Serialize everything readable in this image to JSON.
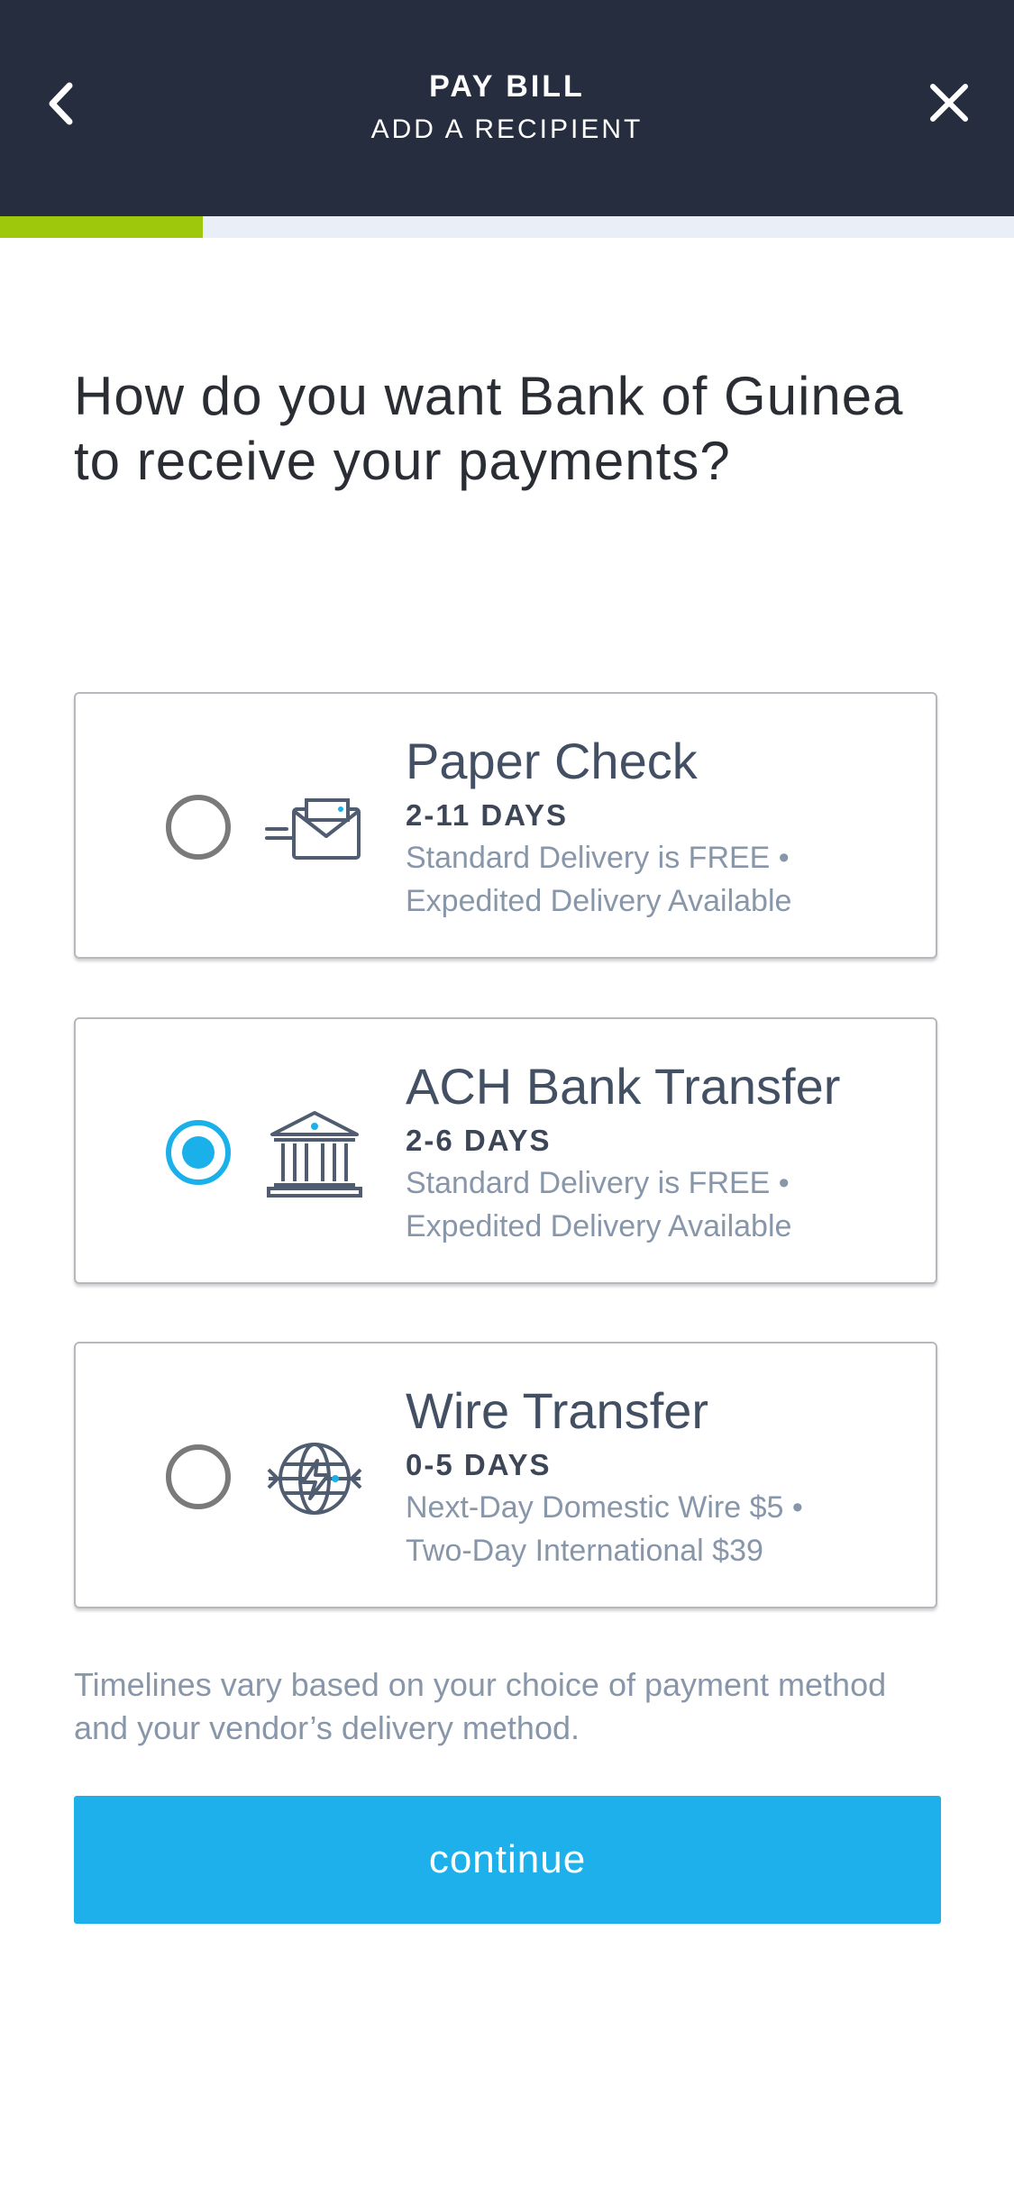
{
  "header": {
    "title": "PAY BILL",
    "subtitle": "ADD A RECIPIENT",
    "background": "#252d3e"
  },
  "progress": {
    "fraction": 0.2,
    "color": "#9ec80b"
  },
  "question": "How do you want Bank of Guinea to receive your payments?",
  "options": [
    {
      "title": "Paper Check",
      "days": "2-11 DAYS",
      "desc_line1": "Standard Delivery is FREE •",
      "desc_line2": "Expedited Delivery Available",
      "icon": "envelope-check-icon",
      "selected": false
    },
    {
      "title": "ACH Bank Transfer",
      "days": "2-6 DAYS",
      "desc_line1": "Standard Delivery is FREE •",
      "desc_line2": "Expedited Delivery Available",
      "icon": "bank-building-icon",
      "selected": true
    },
    {
      "title": "Wire Transfer",
      "days": "0-5 DAYS",
      "desc_line1": "Next-Day Domestic Wire $5 •",
      "desc_line2": "Two-Day International $39",
      "icon": "globe-wire-icon",
      "selected": false
    }
  ],
  "note": "Timelines vary based on your choice of payment method and your vendor’s delivery method.",
  "continue_label": "continue",
  "accent_color": "#1db0ea"
}
